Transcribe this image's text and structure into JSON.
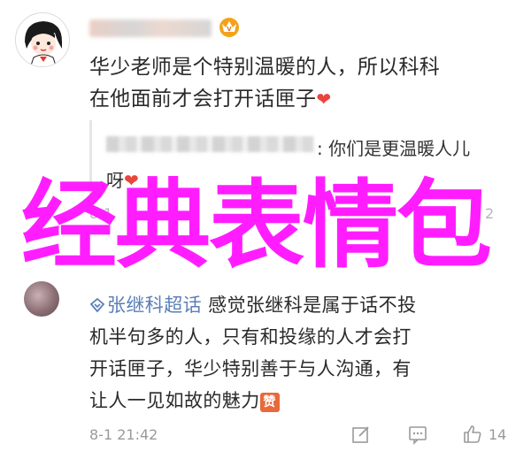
{
  "comment1": {
    "avatar_icon": "cartoon-girl-avatar",
    "badge_icon": "vip-crown-badge",
    "text_line1": "华少老师是个特别温暖的人，所以科科",
    "text_line2": "在他面前才会打开话匣子",
    "heart": "❤"
  },
  "reply": {
    "text_line1": ": 你们是更温暖人儿",
    "text_line2": "呀",
    "heart": "❤"
  },
  "overlay": {
    "title": "经典表情包",
    "color": "#ff1dff"
  },
  "meta1": {
    "time_fragment": "8-1",
    "count_fragment": "2"
  },
  "comment2": {
    "topic_icon": "super-topic-icon",
    "topic": "张继科超话",
    "line1_rest": "  感觉张继科是属于话不投",
    "line2": "机半句多的人，只有和投缘的人才会打",
    "line3": "开话匣子，华少特别善于与人沟通，有",
    "line4": "让人一见如故的魅力",
    "emoji": "赞",
    "timestamp": "8-1 21:42",
    "like_count": "14"
  },
  "colors": {
    "link": "#5b7fb5",
    "heart": "#e8453c",
    "muted": "#9a9a9a"
  }
}
